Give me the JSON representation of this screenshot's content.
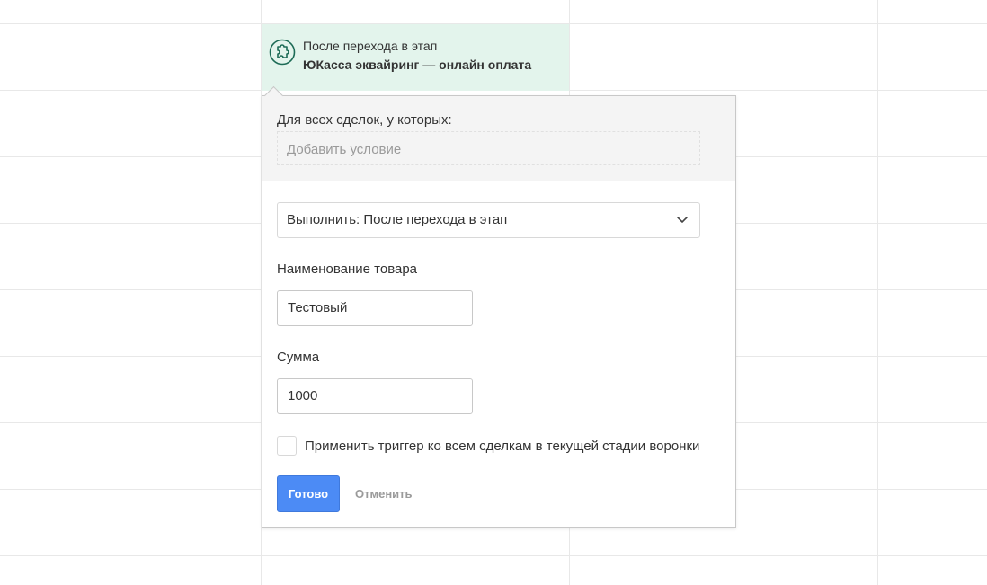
{
  "trigger": {
    "icon": "puzzle-icon",
    "line1": "После перехода в этап",
    "line2": "ЮКасса эквайринг — онлайн оплата",
    "card_color": "#e3f4ec",
    "icon_color": "#1d6b56"
  },
  "popup": {
    "conditions_label": "Для всех сделок, у которых:",
    "add_condition_placeholder": "Добавить условие",
    "execute_select": "Выполнить: После перехода в этап",
    "product_name_label": "Наименование товара",
    "product_name_value": "Тестовый",
    "sum_label": "Сумма",
    "sum_value": "1000",
    "apply_all_label": "Применить триггер ко всем сделкам в текущей стадии воронки",
    "apply_all_checked": false,
    "done_label": "Готово",
    "cancel_label": "Отменить",
    "accent_color": "#4c8bf5"
  }
}
